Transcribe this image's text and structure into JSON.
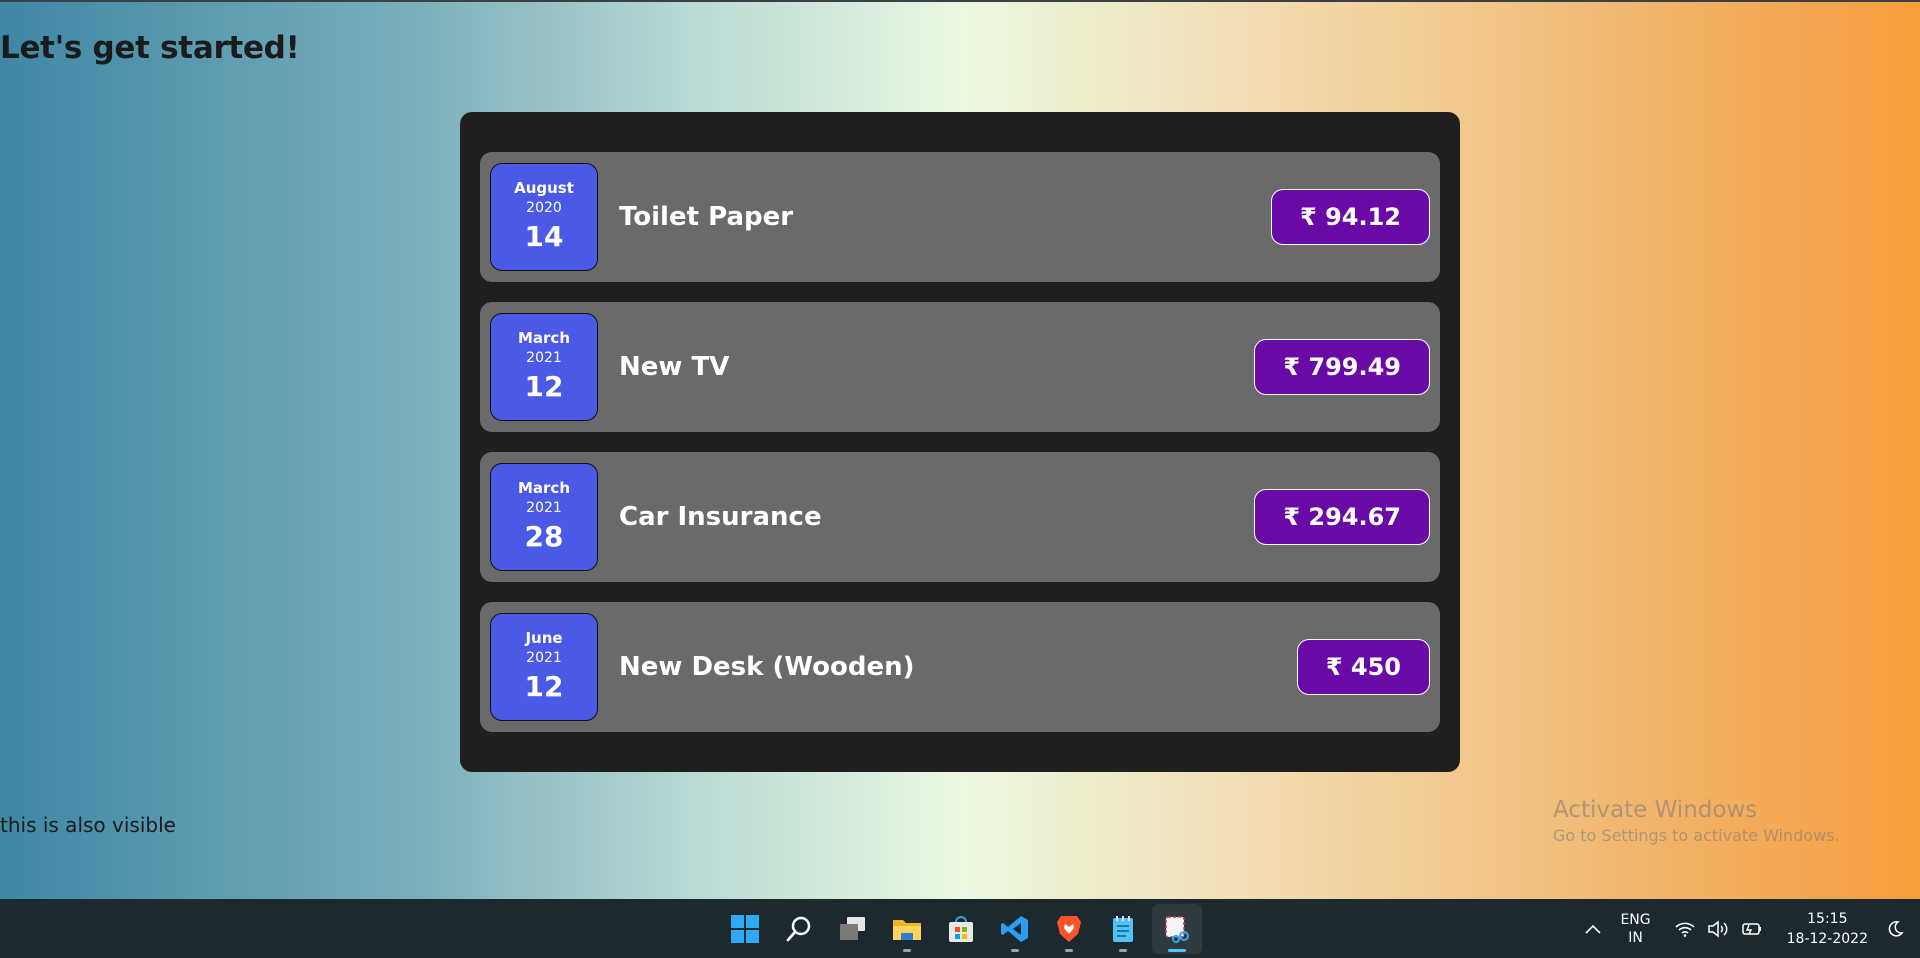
{
  "page": {
    "heading": "Let's get started!",
    "footer_text": "this is also visible"
  },
  "expenses": [
    {
      "month": "August",
      "year": "2020",
      "day": "14",
      "title": "Toilet Paper",
      "amount": "₹ 94.12"
    },
    {
      "month": "March",
      "year": "2021",
      "day": "12",
      "title": "New TV",
      "amount": "₹ 799.49"
    },
    {
      "month": "March",
      "year": "2021",
      "day": "28",
      "title": "Car Insurance",
      "amount": "₹ 294.67"
    },
    {
      "month": "June",
      "year": "2021",
      "day": "12",
      "title": "New Desk (Wooden)",
      "amount": "₹ 450"
    }
  ],
  "watermark": {
    "line1": "Activate Windows",
    "line2": "Go to Settings to activate Windows."
  },
  "taskbar": {
    "apps": [
      {
        "name": "windows-start-icon"
      },
      {
        "name": "search-icon"
      },
      {
        "name": "task-view-icon"
      },
      {
        "name": "file-explorer-icon"
      },
      {
        "name": "microsoft-store-icon"
      },
      {
        "name": "vscode-icon"
      },
      {
        "name": "brave-browser-icon"
      },
      {
        "name": "notepad-icon"
      },
      {
        "name": "snipping-tool-icon"
      }
    ],
    "lang_line1": "ENG",
    "lang_line2": "IN",
    "time": "15:15",
    "date": "18-12-2022"
  },
  "colors": {
    "card_bg": "#1f1f1f",
    "item_bg": "#6a6a6a",
    "date_bg": "#4a5ae6",
    "price_bg": "#6a0aa6",
    "taskbar_bg": "#1c2a2f"
  }
}
